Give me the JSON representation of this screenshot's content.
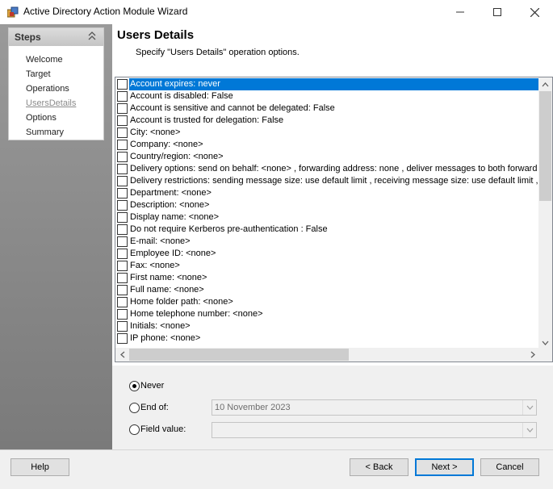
{
  "window": {
    "title": "Active Directory Action Module Wizard",
    "min_icon": "minimize-icon",
    "max_icon": "maximize-icon",
    "close_icon": "close-icon"
  },
  "steps": {
    "header": "Steps",
    "items": [
      {
        "label": "Welcome",
        "current": false
      },
      {
        "label": "Target",
        "current": false
      },
      {
        "label": "Operations",
        "current": false
      },
      {
        "label": "UsersDetails",
        "current": true
      },
      {
        "label": "Options",
        "current": false
      },
      {
        "label": "Summary",
        "current": false
      }
    ]
  },
  "page": {
    "title": "Users Details",
    "subtitle": "Specify \"Users Details\" operation options."
  },
  "list": {
    "items": [
      {
        "text": "Account expires: never",
        "checked": false,
        "selected": true
      },
      {
        "text": "Account is disabled: False",
        "checked": false
      },
      {
        "text": "Account is sensitive and cannot be delegated: False",
        "checked": false
      },
      {
        "text": "Account is trusted for delegation: False",
        "checked": false
      },
      {
        "text": "City: <none>",
        "checked": false
      },
      {
        "text": "Company: <none>",
        "checked": false
      },
      {
        "text": "Country/region: <none>",
        "checked": false
      },
      {
        "text": "Delivery options: send on behalf: <none> , forwarding address: none , deliver messages to both forward",
        "checked": false
      },
      {
        "text": "Delivery restrictions: sending message size: use default limit , receiving message size: use default limit , ac",
        "checked": false
      },
      {
        "text": "Department: <none>",
        "checked": false
      },
      {
        "text": "Description: <none>",
        "checked": false
      },
      {
        "text": "Display name: <none>",
        "checked": false
      },
      {
        "text": "Do not require Kerberos pre-authentication : False",
        "checked": false
      },
      {
        "text": "E-mail: <none>",
        "checked": false
      },
      {
        "text": "Employee ID: <none>",
        "checked": false
      },
      {
        "text": "Fax: <none>",
        "checked": false
      },
      {
        "text": "First name: <none>",
        "checked": false
      },
      {
        "text": "Full name: <none>",
        "checked": false
      },
      {
        "text": "Home folder path: <none>",
        "checked": false
      },
      {
        "text": "Home telephone number: <none>",
        "checked": false
      },
      {
        "text": "Initials: <none>",
        "checked": false
      },
      {
        "text": "IP phone: <none>",
        "checked": false
      }
    ]
  },
  "expiry": {
    "never_label": "Never",
    "endof_label": "End of:",
    "endof_value": "10 November 2023",
    "field_label": "Field value:",
    "field_value": "",
    "selected": "never"
  },
  "buttons": {
    "help": "Help",
    "back": "< Back",
    "next": "Next >",
    "cancel": "Cancel"
  },
  "colors": {
    "selection": "#0078d7",
    "panel_gray": "#8a8a8a"
  }
}
